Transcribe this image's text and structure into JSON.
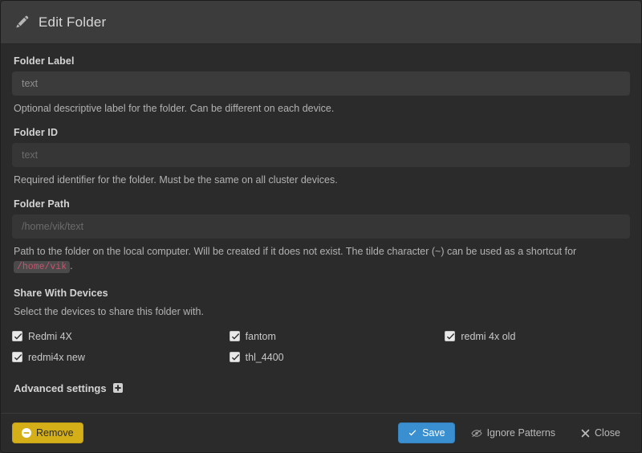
{
  "header": {
    "title": "Edit Folder",
    "icon": "pencil-icon"
  },
  "fields": {
    "folder_label": {
      "label": "Folder Label",
      "value": "",
      "placeholder": "text",
      "help": "Optional descriptive label for the folder. Can be different on each device."
    },
    "folder_id": {
      "label": "Folder ID",
      "value": "",
      "placeholder": "text",
      "help": "Required identifier for the folder. Must be the same on all cluster devices."
    },
    "folder_path": {
      "label": "Folder Path",
      "value": "",
      "placeholder": "/home/vik/text",
      "help_before": "Path to the folder on the local computer. Will be created if it does not exist. The tilde character (~) can be used as a shortcut for",
      "help_code": "/home/vik",
      "help_after": "."
    }
  },
  "share": {
    "heading": "Share With Devices",
    "subtext": "Select the devices to share this folder with.",
    "devices": [
      {
        "label": "Redmi 4X",
        "checked": true
      },
      {
        "label": "fantom",
        "checked": true
      },
      {
        "label": "redmi 4x old",
        "checked": true
      },
      {
        "label": "redmi4x new",
        "checked": true
      },
      {
        "label": "thl_4400",
        "checked": true
      }
    ]
  },
  "advanced": {
    "label": "Advanced settings",
    "icon": "plus-square-icon"
  },
  "footer": {
    "remove_label": "Remove",
    "remove_icon": "minus-circle-icon",
    "save_label": "Save",
    "save_icon": "check-icon",
    "ignore_label": "Ignore Patterns",
    "ignore_icon": "eye-slash-icon",
    "close_label": "Close",
    "close_icon": "times-icon"
  },
  "colors": {
    "header_bg": "#3c3c3c",
    "body_bg": "#2b2b2b",
    "input_bg": "#3b3b3b",
    "accent_primary": "#3a8fd0",
    "accent_warning": "#d4af18",
    "code_text": "#c7546e"
  }
}
